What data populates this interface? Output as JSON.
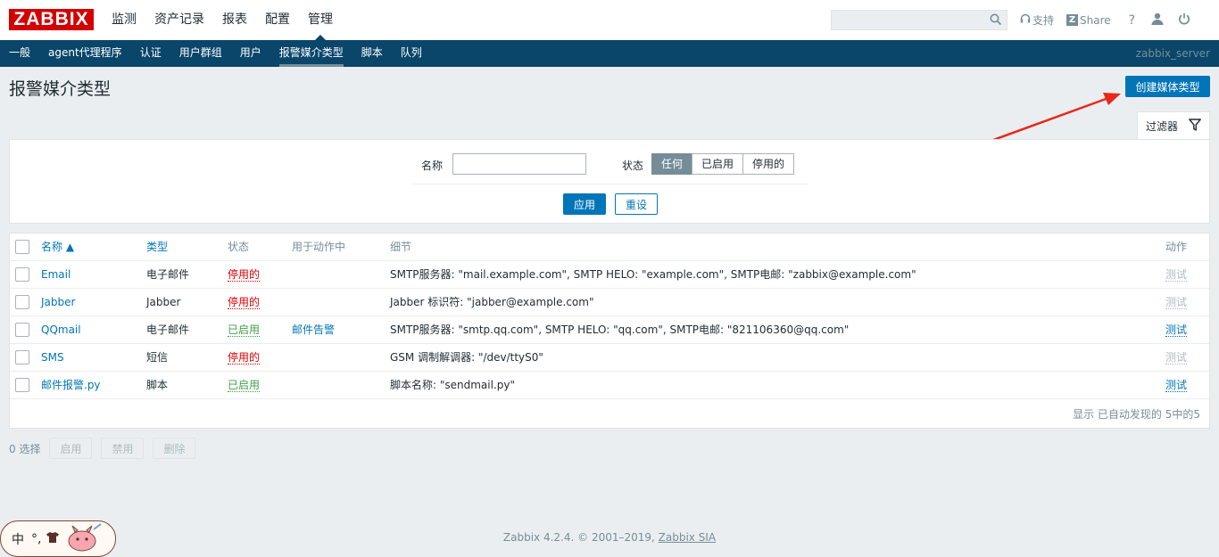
{
  "header": {
    "logo": "ZABBIX",
    "nav": [
      "监测",
      "资产记录",
      "报表",
      "配置",
      "管理"
    ],
    "search_placeholder": "",
    "support": "支持",
    "share": "Share",
    "help": "?"
  },
  "subnav": {
    "items": [
      "一般",
      "agent代理程序",
      "认证",
      "用户群组",
      "用户",
      "报警媒介类型",
      "脚本",
      "队列"
    ],
    "server": "zabbix_server"
  },
  "page": {
    "title": "报警媒介类型",
    "create_button": "创建媒体类型"
  },
  "filter": {
    "tab_label": "过滤器",
    "name_label": "名称",
    "name_value": "",
    "status_label": "状态",
    "status_options": [
      "任何",
      "已启用",
      "停用的"
    ],
    "status_selected": "任何",
    "apply": "应用",
    "reset": "重设"
  },
  "table": {
    "columns": [
      "名称 ▲",
      "类型",
      "状态",
      "用于动作中",
      "细节",
      "动作"
    ],
    "rows": [
      {
        "name": "Email",
        "type": "电子邮件",
        "status": "停用的",
        "status_color": "#dc0000",
        "action": "",
        "details": "SMTP服务器: \"mail.example.com\", SMTP HELO: \"example.com\", SMTP电邮: \"zabbix@example.com\"",
        "test": "测试",
        "test_enabled": false
      },
      {
        "name": "Jabber",
        "type": "Jabber",
        "status": "停用的",
        "status_color": "#dc0000",
        "action": "",
        "details": "Jabber 标识符: \"jabber@example.com\"",
        "test": "测试",
        "test_enabled": false
      },
      {
        "name": "QQmail",
        "type": "电子邮件",
        "status": "已启用",
        "status_color": "#429e47",
        "action": "邮件告警",
        "details": "SMTP服务器: \"smtp.qq.com\", SMTP HELO: \"qq.com\", SMTP电邮: \"821106360@qq.com\"",
        "test": "测试",
        "test_enabled": true
      },
      {
        "name": "SMS",
        "type": "短信",
        "status": "停用的",
        "status_color": "#dc0000",
        "action": "",
        "details": "GSM 调制解调器: \"/dev/ttyS0\"",
        "test": "测试",
        "test_enabled": false
      },
      {
        "name": "邮件报警.py",
        "type": "脚本",
        "status": "已启用",
        "status_color": "#429e47",
        "action": "",
        "details": "脚本名称: \"sendmail.py\"",
        "test": "测试",
        "test_enabled": true
      }
    ],
    "footer": "显示 已自动发现的 5中的5"
  },
  "bulk": {
    "selected": "0 选择",
    "enable": "启用",
    "disable": "禁用",
    "delete": "删除"
  },
  "footer": {
    "text": "Zabbix 4.2.4. © 2001–2019, ",
    "link": "Zabbix SIA"
  },
  "ime": {
    "lang": "中",
    "punct": "°,"
  },
  "colors": {
    "accent": "#0275b8",
    "nav_bg": "#0a466a",
    "logo_bg": "#d40000",
    "disabled": "#dc0000",
    "enabled": "#429e47",
    "annotation_arrow": "#e8291c"
  }
}
